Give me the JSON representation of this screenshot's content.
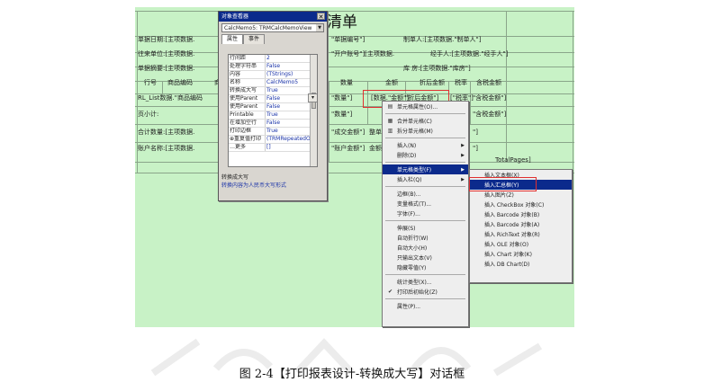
{
  "report": {
    "title": "清单",
    "rows": [
      {
        "id": "row-bill-date",
        "text": "单据日期:[主项数据."
      },
      {
        "id": "row-bill-no",
        "text": "\"单据编号\"]"
      },
      {
        "id": "row-maker",
        "text": "制单人:[主项数据.\"制单人\"]"
      },
      {
        "id": "row-unit",
        "text": "往来单位:[主项数据."
      },
      {
        "id": "row-account",
        "text": "\"开户账号\"][主项数据."
      },
      {
        "id": "row-handler",
        "text": "经手人:[主项数据.\"经手人\"]"
      },
      {
        "id": "row-summary",
        "text": "单据摘要:[主项数据."
      },
      {
        "id": "row-warehouse",
        "text": "库   房:[主项数据.\"库房\"]"
      },
      {
        "id": "col-no",
        "text": "行号"
      },
      {
        "id": "col-code",
        "text": "商品编码"
      },
      {
        "id": "col-c",
        "text": "商"
      },
      {
        "id": "col-qty",
        "text": "数量"
      },
      {
        "id": "col-amount",
        "text": "金额"
      },
      {
        "id": "col-disc",
        "text": "折后金额"
      },
      {
        "id": "col-tax",
        "text": "税率"
      },
      {
        "id": "col-taxamt",
        "text": "含税金额"
      },
      {
        "id": "row-list",
        "text": "RL_List数据.\"商品编码"
      },
      {
        "id": "row-list-qty",
        "text": "\"数量\"]"
      },
      {
        "id": "row-list-amt",
        "text": "[数据.\"金额\"]"
      },
      {
        "id": "row-list-disc",
        "text": "\"折后金额\"]"
      },
      {
        "id": "row-list-tax",
        "text": "[\"税率\"]"
      },
      {
        "id": "row-list-taxamt",
        "text": "\"含税金额\"]"
      },
      {
        "id": "row-pagesub",
        "text": "页小计:"
      },
      {
        "id": "row-pagesub-qty",
        "text": "\"数量\"]"
      },
      {
        "id": "row-pagesub-taxamt",
        "text": "\"含税金额\"]"
      },
      {
        "id": "row-total",
        "text": "合计数量:[主项数据."
      },
      {
        "id": "row-total-amt",
        "text": "\"成交金额\"]"
      },
      {
        "id": "row-total-tax",
        "text": "整单税"
      },
      {
        "id": "row-total-end",
        "text": "\"]"
      },
      {
        "id": "row-acct",
        "text": "账户名称:[主项数据."
      },
      {
        "id": "row-acct-amt",
        "text": "\"账户金额\"]"
      },
      {
        "id": "row-acct-bal",
        "text": "金额"
      },
      {
        "id": "row-acct-end",
        "text": "\"]"
      },
      {
        "id": "row-pages",
        "text": "TotalPages]"
      }
    ]
  },
  "props_dialog": {
    "title": "对象查看器",
    "object": "CalcMemo5: TRMCalcMemoView",
    "tabs": [
      "属性",
      "事件"
    ],
    "properties": [
      {
        "k": "行间距",
        "v": "2"
      },
      {
        "k": "处理字符串",
        "v": "False"
      },
      {
        "k": "内容",
        "v": "(TStrings)"
      },
      {
        "k": "名称",
        "v": "CalcMemo5"
      },
      {
        "k": "转换成大写",
        "v": "True"
      },
      {
        "k": "使用Parent",
        "v": "False"
      },
      {
        "k": "使用Parent",
        "v": "False"
      },
      {
        "k": "Printable",
        "v": "True"
      },
      {
        "k": "在增加空行",
        "v": "False"
      },
      {
        "k": "打印边框",
        "v": "True"
      },
      {
        "k": "⊕重复值打印",
        "v": "(TRMRepeatedO"
      },
      {
        "k": "…更多",
        "v": "[]"
      }
    ],
    "desc_title": "转换成大写",
    "desc_text": "转换内容为人民币大写形式"
  },
  "context_menu": [
    {
      "icon": "properties-icon",
      "label": "单元格属性(O)..."
    },
    {
      "sep": true
    },
    {
      "icon": "merge-icon",
      "label": "合并单元格(C)"
    },
    {
      "icon": "split-icon",
      "label": "拆分单元格(M)"
    },
    {
      "sep": true
    },
    {
      "icon": "",
      "label": "插入(N)",
      "arrow": true
    },
    {
      "icon": "",
      "label": "删除(D)",
      "arrow": true
    },
    {
      "sep": true
    },
    {
      "icon": "",
      "label": "单元格类型(F)",
      "arrow": true,
      "selected": true
    },
    {
      "icon": "",
      "label": "插入栏(Q)",
      "arrow": true
    },
    {
      "sep": true
    },
    {
      "icon": "",
      "label": "边框(B)..."
    },
    {
      "icon": "",
      "label": "变量格式(T)..."
    },
    {
      "icon": "",
      "label": "字体(F)..."
    },
    {
      "sep": true
    },
    {
      "icon": "",
      "label": "伸展(S)"
    },
    {
      "icon": "",
      "label": "自动折行(W)"
    },
    {
      "icon": "",
      "label": "自动大小(H)"
    },
    {
      "icon": "",
      "label": "只输出文本(V)"
    },
    {
      "icon": "",
      "label": "隐藏零值(Y)"
    },
    {
      "sep": true
    },
    {
      "icon": "",
      "label": "统计类型(X)..."
    },
    {
      "icon": "check-icon",
      "label": "打印后初始化(Z)"
    },
    {
      "sep": true
    },
    {
      "icon": "",
      "label": "属性(P)..."
    }
  ],
  "submenu": [
    {
      "label": "插入文本框(X)"
    },
    {
      "label": "插入汇总框(Y)",
      "selected": true
    },
    {
      "label": "插入图片(Z)"
    },
    {
      "label": "插入 CheckBox 对象(C)"
    },
    {
      "label": "插入 Barcode 对象(B)"
    },
    {
      "label": "插入 Barcode 对象(A)"
    },
    {
      "label": "插入 RichText 对象(R)"
    },
    {
      "label": "插入 OLE 对象(O)"
    },
    {
      "label": "插入 Chart 对象(K)"
    },
    {
      "label": "插入 DB Chart(D)"
    }
  ],
  "caption": "图 2-4【打印报表设计-转换成大写】对话框"
}
